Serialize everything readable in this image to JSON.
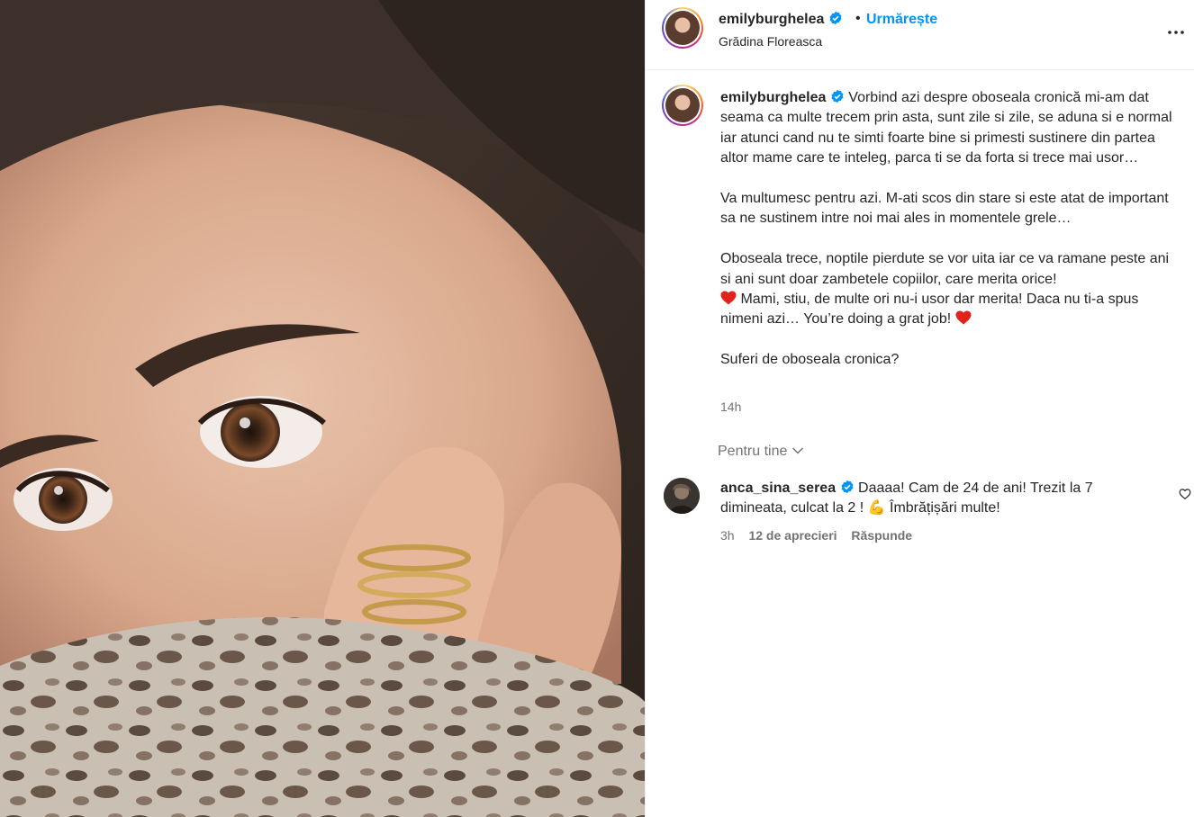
{
  "post": {
    "image_alt": "Close-up photo of a woman's face with teary eyes, hand with gold nail ring, leopard print pillow",
    "username": "emilyburghelea",
    "separator": "•",
    "follow_label": "Urmărește",
    "location": "Grădina Floreasca",
    "more_icon": "more-horizontal-icon"
  },
  "caption": {
    "username": "emilyburghelea",
    "paragraph1": "Vorbind azi despre oboseala cronică mi-am dat seama ca multe trecem prin asta, sunt zile si zile, se aduna si e normal iar atunci cand nu te simti foarte bine si primesti sustinere din partea altor mame care te inteleg, parca ti se da forta si trece mai usor…",
    "paragraph2": "Va multumesc pentru azi. M-ati scos din stare si este atat de important sa ne sustinem intre noi mai ales in momentele grele…",
    "paragraph3a": "Oboseala trece, noptile pierdute se vor uita iar ce va ramane peste ani si ani sunt doar zambetele copiilor, care merita orice!",
    "paragraph3b": " Mami, stiu, de multe ori nu-i usor dar merita! Daca nu ti-a spus nimeni azi… You’re doing a grat job! ",
    "paragraph4": "Suferi de oboseala cronica?",
    "time": "14h"
  },
  "filter": {
    "label": "Pentru tine"
  },
  "comment": {
    "username": "anca_sina_serea",
    "text_a": "Daaaa! Cam de 24 de ani! Trezit la 7 dimineata, culcat la 2 ! ",
    "emoji": "💪",
    "text_b": " Îmbrățișări multe!",
    "time": "3h",
    "likes": "12 de aprecieri",
    "reply_label": "Răspunde"
  },
  "colors": {
    "accent": "#0095f6",
    "text": "#262626",
    "muted": "#737373",
    "heart": "#e0241b",
    "verified": "#0095f6"
  }
}
